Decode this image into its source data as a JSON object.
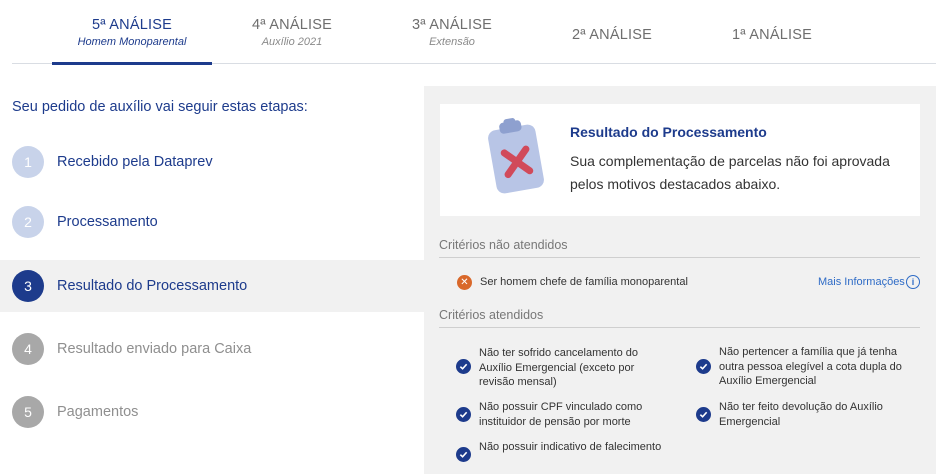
{
  "tabs": [
    {
      "title": "5ª ANÁLISE",
      "subtitle": "Homem Monoparental",
      "active": true
    },
    {
      "title": "4ª ANÁLISE",
      "subtitle": "Auxílio 2021",
      "active": false
    },
    {
      "title": "3ª ANÁLISE",
      "subtitle": "Extensão",
      "active": false
    },
    {
      "title": "2ª ANÁLISE",
      "subtitle": "",
      "active": false
    },
    {
      "title": "1ª ANÁLISE",
      "subtitle": "",
      "active": false
    }
  ],
  "steps": {
    "intro": "Seu pedido de auxílio vai seguir estas etapas:",
    "items": [
      {
        "number": "1",
        "label": "Recebido pela Dataprev",
        "state": "done"
      },
      {
        "number": "2",
        "label": "Processamento",
        "state": "done"
      },
      {
        "number": "3",
        "label": "Resultado do Processamento",
        "state": "current"
      },
      {
        "number": "4",
        "label": "Resultado enviado para Caixa",
        "state": "pending"
      },
      {
        "number": "5",
        "label": "Pagamentos",
        "state": "pending"
      }
    ]
  },
  "result": {
    "icon": "clipboard-x-icon",
    "title": "Resultado do Processamento",
    "message": "Sua complementação de parcelas não foi aprovada pelos motivos destacados abaixo."
  },
  "criteria": {
    "unmet_heading": "Critérios não atendidos",
    "unmet": [
      {
        "text": "Ser homem chefe de família monoparental",
        "link": "Mais Informações"
      }
    ],
    "met_heading": "Critérios atendidos",
    "met": [
      {
        "text": "Não ter sofrido cancelamento do Auxílio Emergencial (exceto por revisão mensal)"
      },
      {
        "text": "Não pertencer a família que já tenha outra pessoa elegível a cota dupla do Auxílio Emergencial"
      },
      {
        "text": "Não possuir CPF vinculado como instituidor de pensão por morte"
      },
      {
        "text": "Não ter feito devolução do Auxílio Emergencial"
      },
      {
        "text": "Não possuir indicativo de falecimento"
      }
    ]
  },
  "colors": {
    "primary": "#1d3b8c",
    "done_step": "#c8d3ea",
    "pending_step": "#a8a8a8",
    "panel_bg": "#f1f1f1",
    "error": "#d9682a",
    "link": "#2e6bc6"
  }
}
